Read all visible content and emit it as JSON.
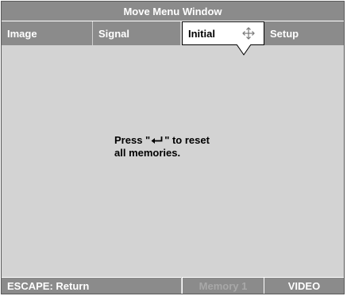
{
  "window": {
    "title": "Move Menu Window"
  },
  "tabs": [
    {
      "label": "Image",
      "active": false
    },
    {
      "label": "Signal",
      "active": false
    },
    {
      "label": "Initial",
      "active": true,
      "icon": "move-arrows-icon"
    },
    {
      "label": "Setup",
      "active": false
    }
  ],
  "content": {
    "message_before_icon": "Press \"",
    "message_icon": "enter-key-icon",
    "message_after_icon": "\" to reset",
    "message_line2": "all memories."
  },
  "statusbar": {
    "escape_label": "ESCAPE: Return",
    "memory_label": "Memory 1",
    "source_label": "VIDEO"
  },
  "colors": {
    "bar_gray": "#8b8b8b",
    "body_gray": "#d3d3d3",
    "active_tab_bg": "#ffffff",
    "dim_text": "#a8a8a8"
  }
}
